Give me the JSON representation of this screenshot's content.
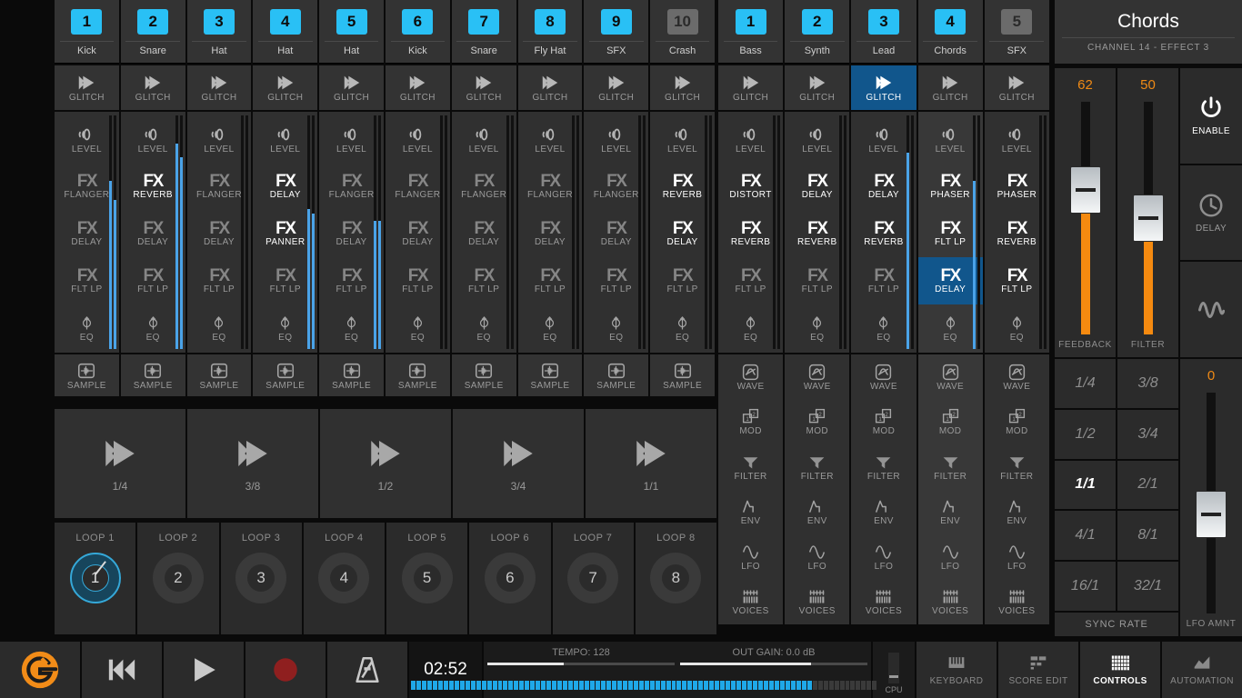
{
  "app": {
    "name": "groove-machine"
  },
  "drum_bank": {
    "channels": [
      {
        "num": "1",
        "name": "Kick",
        "active": true,
        "glitch": "GLITCH",
        "glitch_sel": false,
        "level": "LEVEL",
        "fx": [
          {
            "name": "FLANGER",
            "on": false
          },
          {
            "name": "DELAY",
            "on": false
          },
          {
            "name": "FLT LP",
            "on": false
          }
        ],
        "eq": "EQ",
        "sample": "SAMPLE",
        "meters": [
          72,
          64
        ]
      },
      {
        "num": "2",
        "name": "Snare",
        "active": true,
        "glitch": "GLITCH",
        "glitch_sel": false,
        "level": "LEVEL",
        "fx": [
          {
            "name": "REVERB",
            "on": true
          },
          {
            "name": "DELAY",
            "on": false
          },
          {
            "name": "FLT LP",
            "on": false
          }
        ],
        "eq": "EQ",
        "sample": "SAMPLE",
        "meters": [
          88,
          82
        ]
      },
      {
        "num": "3",
        "name": "Hat",
        "active": true,
        "glitch": "GLITCH",
        "glitch_sel": false,
        "level": "LEVEL",
        "fx": [
          {
            "name": "FLANGER",
            "on": false
          },
          {
            "name": "DELAY",
            "on": false
          },
          {
            "name": "FLT LP",
            "on": false
          }
        ],
        "eq": "EQ",
        "sample": "SAMPLE",
        "meters": [
          0,
          0
        ]
      },
      {
        "num": "4",
        "name": "Hat",
        "active": true,
        "glitch": "GLITCH",
        "glitch_sel": false,
        "level": "LEVEL",
        "fx": [
          {
            "name": "DELAY",
            "on": true
          },
          {
            "name": "PANNER",
            "on": true
          },
          {
            "name": "FLT LP",
            "on": false
          }
        ],
        "eq": "EQ",
        "sample": "SAMPLE",
        "meters": [
          60,
          58
        ]
      },
      {
        "num": "5",
        "name": "Hat",
        "active": true,
        "glitch": "GLITCH",
        "glitch_sel": false,
        "level": "LEVEL",
        "fx": [
          {
            "name": "FLANGER",
            "on": false
          },
          {
            "name": "DELAY",
            "on": false
          },
          {
            "name": "FLT LP",
            "on": false
          }
        ],
        "eq": "EQ",
        "sample": "SAMPLE",
        "meters": [
          55,
          55
        ]
      },
      {
        "num": "6",
        "name": "Kick",
        "active": true,
        "glitch": "GLITCH",
        "glitch_sel": false,
        "level": "LEVEL",
        "fx": [
          {
            "name": "FLANGER",
            "on": false
          },
          {
            "name": "DELAY",
            "on": false
          },
          {
            "name": "FLT LP",
            "on": false
          }
        ],
        "eq": "EQ",
        "sample": "SAMPLE",
        "meters": [
          0,
          0
        ]
      },
      {
        "num": "7",
        "name": "Snare",
        "active": true,
        "glitch": "GLITCH",
        "glitch_sel": false,
        "level": "LEVEL",
        "fx": [
          {
            "name": "FLANGER",
            "on": false
          },
          {
            "name": "DELAY",
            "on": false
          },
          {
            "name": "FLT LP",
            "on": false
          }
        ],
        "eq": "EQ",
        "sample": "SAMPLE",
        "meters": [
          0,
          0
        ]
      },
      {
        "num": "8",
        "name": "Fly Hat",
        "active": true,
        "glitch": "GLITCH",
        "glitch_sel": false,
        "level": "LEVEL",
        "fx": [
          {
            "name": "FLANGER",
            "on": false
          },
          {
            "name": "DELAY",
            "on": false
          },
          {
            "name": "FLT LP",
            "on": false
          }
        ],
        "eq": "EQ",
        "sample": "SAMPLE",
        "meters": [
          0,
          0
        ]
      },
      {
        "num": "9",
        "name": "SFX",
        "active": true,
        "glitch": "GLITCH",
        "glitch_sel": false,
        "level": "LEVEL",
        "fx": [
          {
            "name": "FLANGER",
            "on": false
          },
          {
            "name": "DELAY",
            "on": false
          },
          {
            "name": "FLT LP",
            "on": false
          }
        ],
        "eq": "EQ",
        "sample": "SAMPLE",
        "meters": [
          0,
          0
        ]
      },
      {
        "num": "10",
        "name": "Crash",
        "active": false,
        "glitch": "GLITCH",
        "glitch_sel": false,
        "level": "LEVEL",
        "fx": [
          {
            "name": "REVERB",
            "on": true
          },
          {
            "name": "DELAY",
            "on": true
          },
          {
            "name": "FLT LP",
            "on": false
          }
        ],
        "eq": "EQ",
        "sample": "SAMPLE",
        "meters": [
          0,
          0
        ]
      }
    ]
  },
  "synth_bank": {
    "channels": [
      {
        "num": "1",
        "name": "Bass",
        "active": true,
        "glitch": "GLITCH",
        "glitch_sel": false,
        "lit": false,
        "level": "LEVEL",
        "fx": [
          {
            "name": "DISTORT",
            "on": true
          },
          {
            "name": "REVERB",
            "on": true
          },
          {
            "name": "FLT LP",
            "on": false,
            "sel": false
          }
        ],
        "eq": "EQ",
        "meters": [
          0,
          0
        ],
        "params": [
          "WAVE",
          "MOD",
          "FILTER",
          "ENV",
          "LFO",
          "VOICES"
        ]
      },
      {
        "num": "2",
        "name": "Synth",
        "active": true,
        "glitch": "GLITCH",
        "glitch_sel": false,
        "lit": false,
        "level": "LEVEL",
        "fx": [
          {
            "name": "DELAY",
            "on": true
          },
          {
            "name": "REVERB",
            "on": true
          },
          {
            "name": "FLT LP",
            "on": false,
            "sel": false
          }
        ],
        "eq": "EQ",
        "meters": [
          0,
          0
        ],
        "params": [
          "WAVE",
          "MOD",
          "FILTER",
          "ENV",
          "LFO",
          "VOICES"
        ]
      },
      {
        "num": "3",
        "name": "Lead",
        "active": true,
        "glitch": "GLITCH",
        "glitch_sel": true,
        "lit": false,
        "level": "LEVEL",
        "fx": [
          {
            "name": "DELAY",
            "on": true
          },
          {
            "name": "REVERB",
            "on": true
          },
          {
            "name": "FLT LP",
            "on": false,
            "sel": false
          }
        ],
        "eq": "EQ",
        "meters": [
          84,
          0
        ],
        "params": [
          "WAVE",
          "MOD",
          "FILTER",
          "ENV",
          "LFO",
          "VOICES"
        ]
      },
      {
        "num": "4",
        "name": "Chords",
        "active": true,
        "glitch": "GLITCH",
        "glitch_sel": false,
        "lit": true,
        "level": "LEVEL",
        "fx": [
          {
            "name": "PHASER",
            "on": true
          },
          {
            "name": "FLT LP",
            "on": true
          },
          {
            "name": "DELAY",
            "on": true,
            "sel": true
          }
        ],
        "eq": "EQ",
        "meters": [
          72,
          0
        ],
        "params": [
          "WAVE",
          "MOD",
          "FILTER",
          "ENV",
          "LFO",
          "VOICES"
        ]
      },
      {
        "num": "5",
        "name": "SFX",
        "active": false,
        "glitch": "GLITCH",
        "glitch_sel": false,
        "lit": false,
        "level": "LEVEL",
        "fx": [
          {
            "name": "PHASER",
            "on": true
          },
          {
            "name": "REVERB",
            "on": true
          },
          {
            "name": "FLT LP",
            "on": true,
            "sel": false
          }
        ],
        "eq": "EQ",
        "meters": [
          0,
          0
        ],
        "params": [
          "WAVE",
          "MOD",
          "FILTER",
          "ENV",
          "LFO",
          "VOICES"
        ]
      }
    ]
  },
  "glitch_rates": [
    {
      "label": "1/4"
    },
    {
      "label": "3/8"
    },
    {
      "label": "1/2"
    },
    {
      "label": "3/4"
    },
    {
      "label": "1/1"
    }
  ],
  "loops": [
    {
      "label": "LOOP 1",
      "num": "1",
      "active": true
    },
    {
      "label": "LOOP 2",
      "num": "2",
      "active": false
    },
    {
      "label": "LOOP 3",
      "num": "3",
      "active": false
    },
    {
      "label": "LOOP 4",
      "num": "4",
      "active": false
    },
    {
      "label": "LOOP 5",
      "num": "5",
      "active": false
    },
    {
      "label": "LOOP 6",
      "num": "6",
      "active": false
    },
    {
      "label": "LOOP 7",
      "num": "7",
      "active": false
    },
    {
      "label": "LOOP 8",
      "num": "8",
      "active": false
    }
  ],
  "fx_panel": {
    "title": "Chords",
    "subtitle": "CHANNEL 14 - EFFECT 3",
    "sliders": [
      {
        "name": "FEEDBACK",
        "value": "62",
        "pct": 62
      },
      {
        "name": "FILTER",
        "value": "50",
        "pct": 50
      }
    ],
    "buttons": [
      {
        "label": "ENABLE",
        "icon": "power-icon",
        "on": true
      },
      {
        "label": "DELAY",
        "icon": "clock-icon",
        "on": false
      },
      {
        "label": "",
        "icon": "waveform-icon",
        "on": false
      }
    ],
    "sync_rate_label": "SYNC RATE",
    "sync_rates": [
      {
        "label": "1/4",
        "on": false
      },
      {
        "label": "3/8",
        "on": false
      },
      {
        "label": "1/2",
        "on": false
      },
      {
        "label": "3/4",
        "on": false
      },
      {
        "label": "1/1",
        "on": true
      },
      {
        "label": "2/1",
        "on": false
      },
      {
        "label": "4/1",
        "on": false
      },
      {
        "label": "8/1",
        "on": false
      },
      {
        "label": "16/1",
        "on": false
      },
      {
        "label": "32/1",
        "on": false
      }
    ],
    "lfo": {
      "name": "LFO AMNT",
      "value": "0",
      "pct": 0
    }
  },
  "transport": {
    "logo": "app-logo-icon",
    "buttons": [
      {
        "name": "rewind-button",
        "icon": "rewind-icon"
      },
      {
        "name": "play-button",
        "icon": "play-icon"
      },
      {
        "name": "record-button",
        "icon": "record-icon"
      },
      {
        "name": "metronome-button",
        "icon": "metronome-icon"
      }
    ],
    "time": "02:52",
    "tempo": {
      "label": "TEMPO: 128",
      "pct": 41
    },
    "out_gain": {
      "label": "OUT GAIN: 0.0 dB",
      "pct": 70
    },
    "led_pct": 86,
    "cpu_label": "CPU",
    "view_tabs": [
      {
        "label": "KEYBOARD",
        "icon": "keyboard-icon",
        "active": false
      },
      {
        "label": "SCORE EDIT",
        "icon": "score-icon",
        "active": false
      },
      {
        "label": "CONTROLS",
        "icon": "grid-icon",
        "active": true
      },
      {
        "label": "AUTOMATION",
        "icon": "automation-icon",
        "active": false
      }
    ]
  },
  "colors": {
    "accent_blue": "#29c0f5",
    "select_blue": "#11568c",
    "orange": "#f58a10",
    "panel": "#2b2b2b",
    "tile": "#333333"
  }
}
